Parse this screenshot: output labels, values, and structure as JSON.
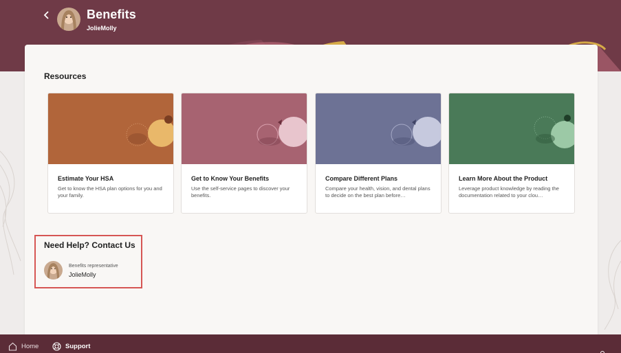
{
  "header": {
    "title": "Benefits",
    "subtitle": "JolieMolly",
    "back_icon": "chevron-left-icon",
    "bg_color": "#6f3a47"
  },
  "resources": {
    "title": "Resources",
    "cards": [
      {
        "title": "Estimate Your HSA",
        "description": "Get to know the HSA plan options for you and your family.",
        "color": "#b1653a"
      },
      {
        "title": "Get to Know Your Benefits",
        "description": "Use the self-service pages to discover your benefits.",
        "color": "#a76371"
      },
      {
        "title": "Compare Different Plans",
        "description": "Compare your health, vision, and dental plans to decide on the best plan before…",
        "color": "#6d7295"
      },
      {
        "title": "Learn More About the Product",
        "description": "Leverage product knowledge by reading the documentation related to your clou…",
        "color": "#4a7a58"
      }
    ]
  },
  "help": {
    "title": "Need Help? Contact Us",
    "contact": {
      "role": "Benefits representative",
      "name": "JolieMolly"
    },
    "highlight_color": "#d65553"
  },
  "footer": {
    "home_label": "Home",
    "support_label": "Support",
    "home_icon": "home-icon",
    "support_icon": "lifebuoy-icon",
    "bg_color": "#5b2c37"
  }
}
